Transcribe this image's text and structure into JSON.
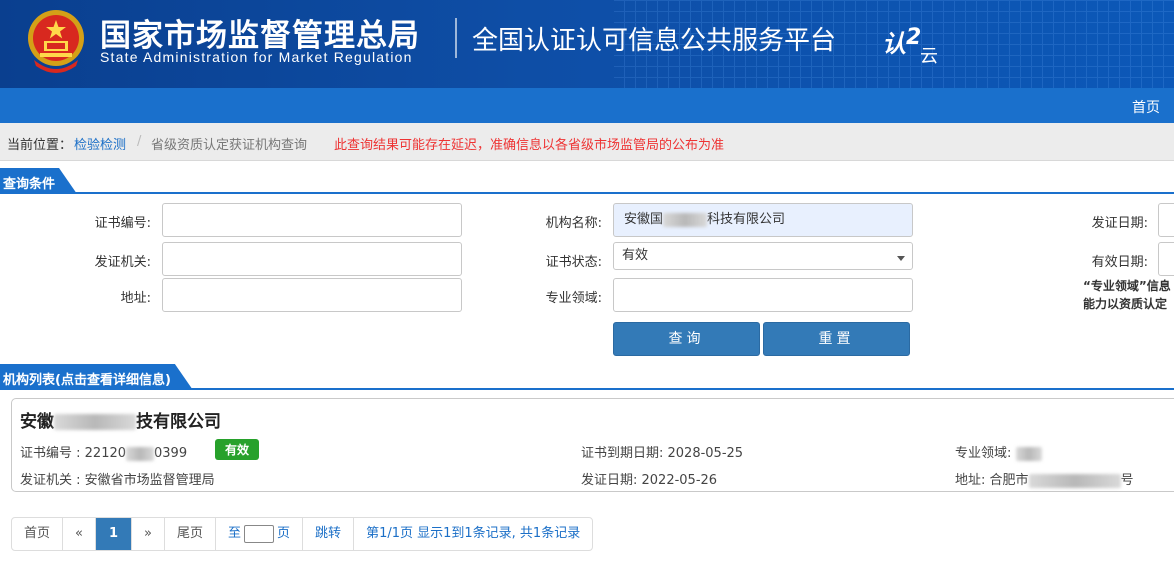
{
  "header": {
    "org_name_cn": "国家市场监督管理总局",
    "org_name_en": "State Administration  for  Market Regulation",
    "platform_name": "全国认证认可信息公共服务平台",
    "logo_text": "认云"
  },
  "nav": {
    "home": "首页"
  },
  "breadcrumb": {
    "label": "当前位置：",
    "link": "检验检测",
    "separator": "/",
    "current": "省级资质认定获证机构查询",
    "warning": "此查询结果可能存在延迟，准确信息以各省级市场监管局的公布为准"
  },
  "query": {
    "section_title": "查询条件",
    "cert_no_label": "证书编号:",
    "cert_no_value": "",
    "issuer_label": "发证机关:",
    "issuer_value": "",
    "address_label": "地址:",
    "address_value": "",
    "org_name_label": "机构名称:",
    "org_name_value_prefix": "安徽国",
    "org_name_value_suffix": "科技有限公司",
    "status_label": "证书状态:",
    "status_value": "有效",
    "field_label": "专业领域:",
    "field_value": "",
    "issue_date_label": "发证日期:",
    "valid_date_label": "有效日期:",
    "note_line1": "“专业领域”信息",
    "note_line2": "能力以资质认定",
    "search_button": "查询",
    "reset_button": "重置"
  },
  "results": {
    "section_title": "机构列表(点击查看详细信息)",
    "items": [
      {
        "org_prefix": "安徽",
        "org_suffix": "技有限公司",
        "cert_no_label": "证书编号 : ",
        "cert_no_prefix": "22120",
        "cert_no_suffix": "0399",
        "status": "有效",
        "expiry_label": "证书到期日期: ",
        "expiry_value": "2028-05-25",
        "field_label": "专业领域: ",
        "issuer_label": "发证机关 : ",
        "issuer_value": "安徽省市场监督管理局",
        "issue_date_label": "发证日期: ",
        "issue_date_value": "2022-05-26",
        "address_label": "地址: ",
        "address_prefix": "合肥市",
        "address_suffix": "号"
      }
    ]
  },
  "pagination": {
    "first": "首页",
    "prev": "«",
    "current_page": "1",
    "next": "»",
    "last": "尾页",
    "goto_prefix": "至",
    "goto_suffix": "页",
    "jump": "跳转",
    "summary": "第1/1页  显示1到1条记录, 共1条记录"
  },
  "colors": {
    "banner": "#0e4ea6",
    "nav": "#1a70cc",
    "button": "#337ab7",
    "valid_badge": "#27a12b",
    "warning": "#ee3333"
  }
}
